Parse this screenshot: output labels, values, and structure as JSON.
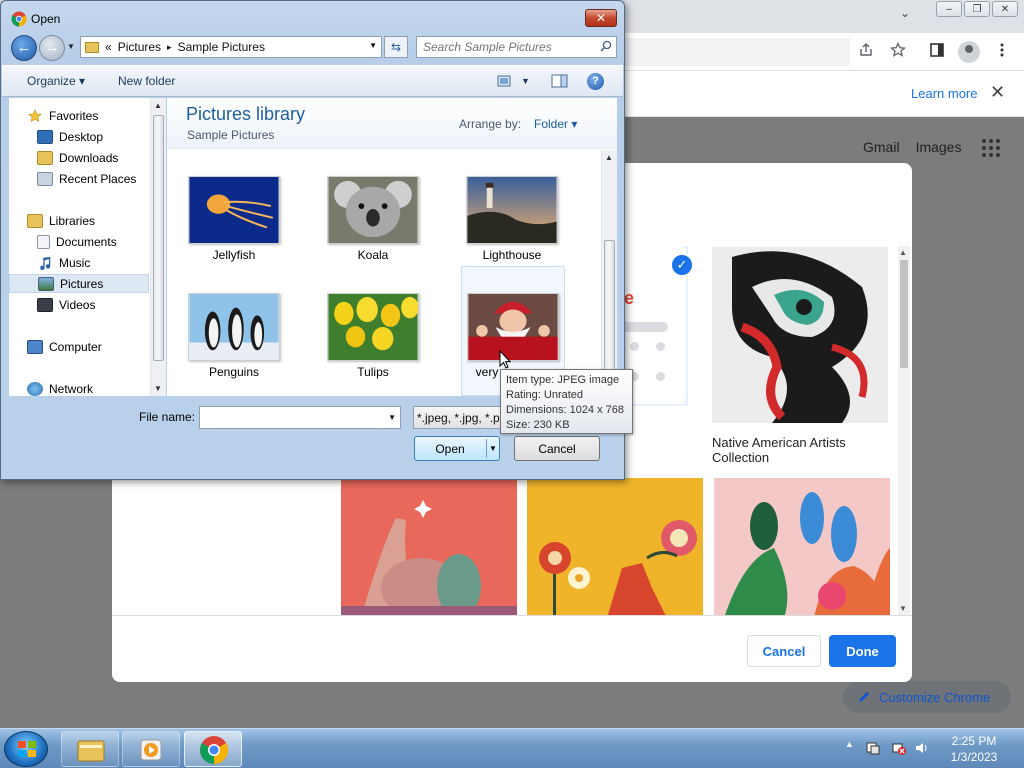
{
  "chrome": {
    "window_controls": [
      "–",
      "❐",
      "✕"
    ],
    "tab_list_glyph": "⌄",
    "infobar": {
      "learn_more": "Learn more",
      "close_glyph": "✕"
    },
    "ntp": {
      "gmail": "Gmail",
      "images": "Images",
      "customize_label": "Customize Chrome"
    },
    "icons": [
      "share-icon",
      "star-icon",
      "side-panel-icon",
      "profile-icon",
      "menu-icon",
      "apps-icon",
      "pencil-icon"
    ]
  },
  "customize_dialog": {
    "selected_tile_text": "gle",
    "selected_check": "✓",
    "native_label": "Native American Artists Collection",
    "cancel_label": "Cancel",
    "done_label": "Done"
  },
  "open_dialog": {
    "title": "Open",
    "close_glyph": "✕",
    "back_glyph": "←",
    "forward_glyph": "→",
    "breadcrumb": {
      "overflow": "«",
      "separator": "▸",
      "items": [
        "Pictures",
        "Sample Pictures"
      ]
    },
    "search_placeholder": "Search Sample Pictures",
    "toolbar": {
      "organize": "Organize",
      "new_folder": "New folder",
      "help": "?"
    },
    "nav": {
      "favorites": "Favorites",
      "desktop": "Desktop",
      "downloads": "Downloads",
      "recent": "Recent Places",
      "libraries": "Libraries",
      "documents": "Documents",
      "music": "Music",
      "pictures": "Pictures",
      "videos": "Videos",
      "computer": "Computer",
      "network": "Network"
    },
    "library": {
      "title": "Pictures library",
      "subtitle": "Sample Pictures",
      "arrange_label": "Arrange by:",
      "arrange_value": "Folder"
    },
    "files": [
      "Jellyfish",
      "Koala",
      "Lighthouse",
      "Penguins",
      "Tulips",
      "very"
    ],
    "tooltip": {
      "type": "Item type: JPEG image",
      "rating": "Rating: Unrated",
      "dimensions": "Dimensions: 1024 x 768",
      "size": "Size: 230 KB"
    },
    "file_name_label": "File name:",
    "file_name_value": "",
    "filter": "*.jpeg, *.jpg, *.p",
    "open_label": "Open",
    "cancel_label": "Cancel"
  },
  "taskbar": {
    "tray_arrow": "▲",
    "time": "2:25 PM",
    "date": "1/3/2023"
  },
  "colors": {
    "accent": "#1a73e8",
    "explorer_title": "#1e5e9e",
    "close_red": "#c4492f"
  }
}
